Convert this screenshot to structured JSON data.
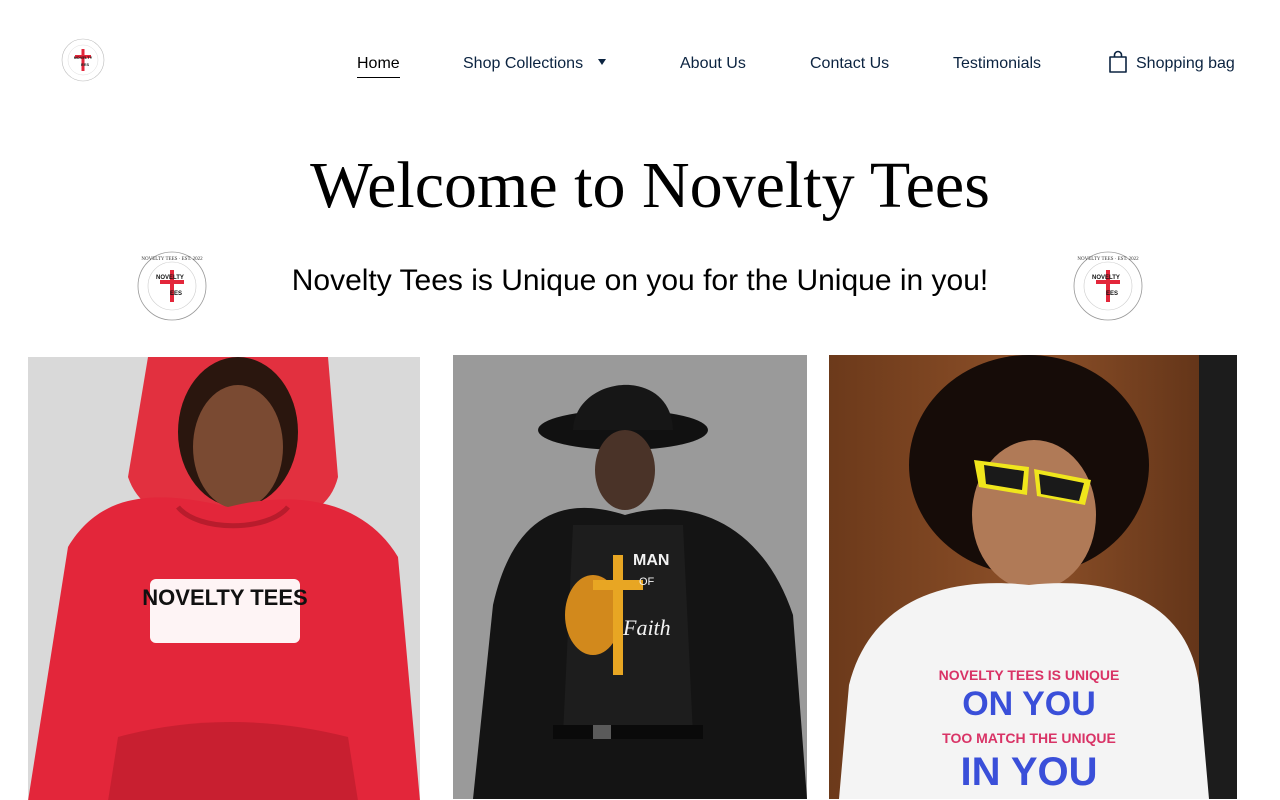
{
  "brand": {
    "logo_alt": "Novelty Tees logo",
    "badge_text_top": "NOVELTY TEES",
    "badge_text_est": "EST. 2022",
    "badge_center": "NOVELTY TEES"
  },
  "nav": {
    "home": "Home",
    "shop": "Shop Collections",
    "about": "About Us",
    "contact": "Contact Us",
    "testimonials": "Testimonials",
    "bag": "Shopping bag"
  },
  "hero": {
    "title": "Welcome to Novelty Tees",
    "tagline": "Novelty Tees is Unique on you for the Unique in you!"
  },
  "products": [
    {
      "shirt_text": "NOVELTY TEES",
      "garment": "red hoodie"
    },
    {
      "shirt_text_1": "MAN",
      "shirt_text_2": "OF",
      "shirt_text_3": "Faith",
      "garment": "black t-shirt"
    },
    {
      "shirt_text_1": "NOVELTY TEES IS UNIQUE",
      "shirt_text_2": "ON YOU",
      "shirt_text_3": "TOO MATCH THE UNIQUE",
      "shirt_text_4": "IN YOU",
      "garment": "white t-shirt"
    }
  ],
  "colors": {
    "nav_text": "#0b2340",
    "accent_red": "#e3263a",
    "brand_black": "#000000"
  }
}
